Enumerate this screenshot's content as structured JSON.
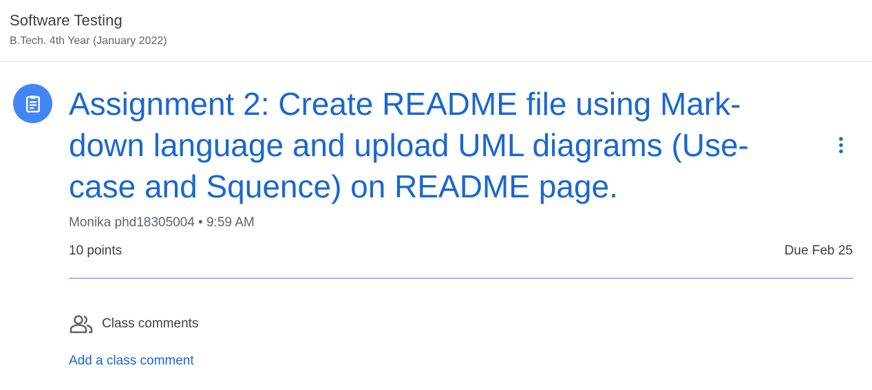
{
  "course": {
    "title": "Software Testing",
    "subtitle": "B.Tech. 4th Year (January 2022)"
  },
  "assignment": {
    "icon": "assignment-clipboard-icon",
    "title_lines": [
      "Assignment 2: Create README file using Mark-",
      "down language and upload UML diagrams (Use-",
      "case and Squence) on README page."
    ],
    "author": "Monika phd18305004",
    "separator": "•",
    "time": "9:59 AM",
    "points": "10 points",
    "due": "Due Feb 25",
    "more_icon": "more-vert-icon"
  },
  "comments": {
    "icon": "people-icon",
    "heading": "Class comments",
    "add_label": "Add a class comment"
  },
  "colors": {
    "accent": "#1967d2",
    "icon_bg": "#4285f4",
    "divider": "#4285f4",
    "text": "#3c4043",
    "secondary_text": "#5f6368"
  }
}
